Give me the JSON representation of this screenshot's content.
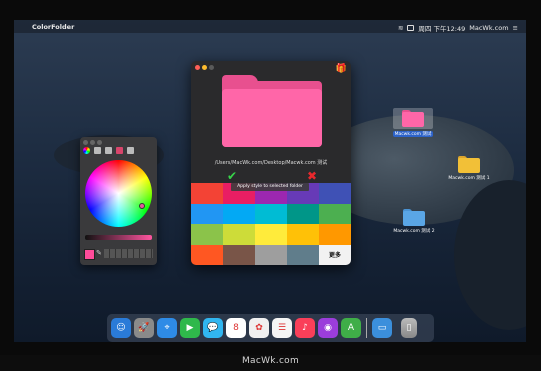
{
  "menubar": {
    "app_name": "ColorFolder",
    "datetime": "周四 下午12:49",
    "site": "MacWk.com"
  },
  "main_window": {
    "path_label": "/Users/MacWk.com/Desktop/Macwk.com 测试",
    "tooltip": "Apply style to selected folder",
    "confirm_icon": "checkmark-icon",
    "cancel_icon": "cross-icon",
    "gift_icon": "gift-icon",
    "more_label": "更多",
    "folder_color": "#ff66a8",
    "palette": [
      "#f34335",
      "#e91e63",
      "#9c27b0",
      "#673ab7",
      "#3f51b5",
      "#2196f3",
      "#03a9f4",
      "#00bcd4",
      "#009688",
      "#4caf50",
      "#8bc34a",
      "#cddc39",
      "#ffeb3b",
      "#ffc107",
      "#ff9800",
      "#ff5722",
      "#795548",
      "#9e9e9e",
      "#607d8b"
    ]
  },
  "color_panel": {
    "selected_color": "#ff4c9a",
    "tools": [
      "color-wheel-icon",
      "sliders-icon",
      "palette-icon",
      "image-icon",
      "pencils-icon"
    ]
  },
  "desktop": {
    "icons": [
      {
        "label": "Macwk.com 测试",
        "color": "#ff66a8"
      },
      {
        "label": "Macwk.com 测试 1",
        "color": "#f2c037"
      },
      {
        "label": "Macwk.com 测试 2",
        "color": "#5aa6e6"
      }
    ]
  },
  "dock": {
    "apps": [
      {
        "name": "finder-icon",
        "glyph": "☺",
        "color": "#2a7bd8"
      },
      {
        "name": "launchpad-icon",
        "glyph": "🚀",
        "color": "#8a8a8a"
      },
      {
        "name": "safari-icon",
        "glyph": "⌖",
        "color": "#2e8be6"
      },
      {
        "name": "facetime-icon",
        "glyph": "▶",
        "color": "#2fb84b"
      },
      {
        "name": "messages-icon",
        "glyph": "💬",
        "color": "#31b6f0"
      },
      {
        "name": "calendar-icon",
        "glyph": "8",
        "color": "#ffffff"
      },
      {
        "name": "photos-icon",
        "glyph": "✿",
        "color": "#f0f0f0"
      },
      {
        "name": "reminders-icon",
        "glyph": "☰",
        "color": "#f5f5f5"
      },
      {
        "name": "music-icon",
        "glyph": "♪",
        "color": "#fa3f59"
      },
      {
        "name": "podcasts-icon",
        "glyph": "◉",
        "color": "#9b3ddb"
      },
      {
        "name": "appstore-icon",
        "glyph": "A",
        "color": "#3fae48"
      },
      {
        "name": "folder-icon",
        "glyph": "▭",
        "color": "#3b8fdc"
      }
    ],
    "trash_icon": "trash-icon"
  },
  "footer": {
    "brand": "MacWk.com"
  }
}
